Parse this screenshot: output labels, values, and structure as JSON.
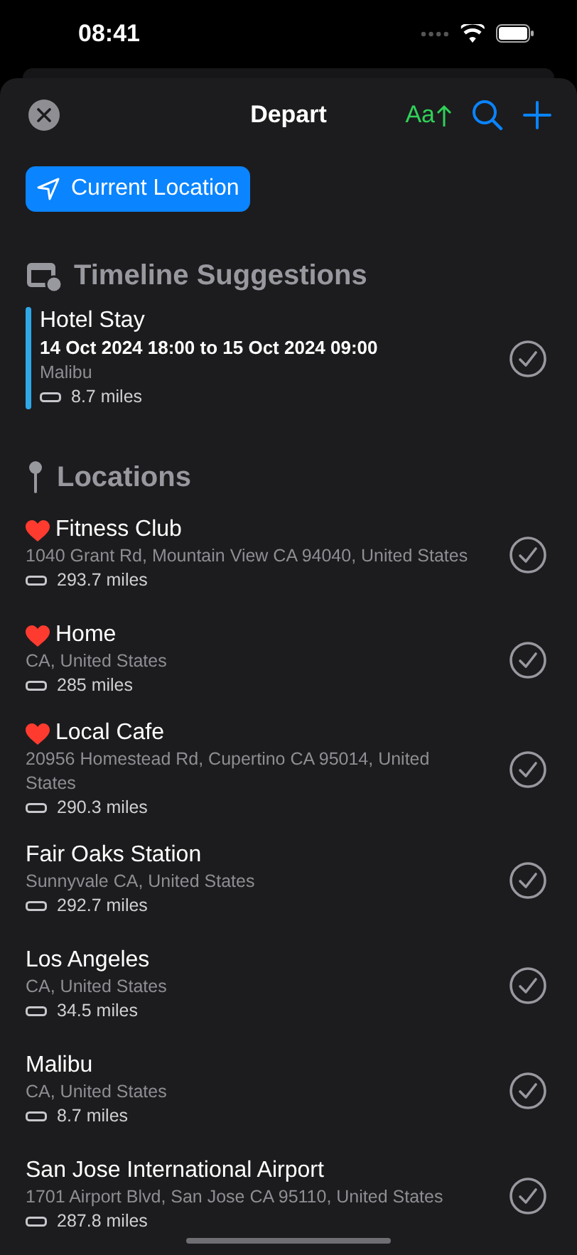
{
  "status_bar": {
    "time": "08:41"
  },
  "header": {
    "title": "Depart",
    "font_button": "Aa"
  },
  "current_location_button": "Current Location",
  "timeline": {
    "heading": "Timeline Suggestions",
    "items": [
      {
        "title": "Hotel Stay",
        "dates": "14 Oct 2024 18:00 to 15 Oct 2024 09:00",
        "place": "Malibu",
        "distance": "8.7 miles",
        "color": "#2fa8e8"
      }
    ]
  },
  "locations": {
    "heading": "Locations",
    "items": [
      {
        "name": "Fitness Club",
        "favorite": true,
        "address": "1040 Grant Rd, Mountain View CA 94040, United States",
        "distance": "293.7 miles"
      },
      {
        "name": "Home",
        "favorite": true,
        "address": "CA, United States",
        "distance": "285 miles"
      },
      {
        "name": "Local Cafe",
        "favorite": true,
        "address": "20956 Homestead Rd, Cupertino CA 95014, United States",
        "distance": "290.3 miles"
      },
      {
        "name": "Fair Oaks Station",
        "favorite": false,
        "address": "Sunnyvale CA, United States",
        "distance": "292.7 miles"
      },
      {
        "name": "Los Angeles",
        "favorite": false,
        "address": "CA, United States",
        "distance": "34.5 miles"
      },
      {
        "name": "Malibu",
        "favorite": false,
        "address": "CA, United States",
        "distance": "8.7 miles"
      },
      {
        "name": "San Jose International Airport",
        "favorite": false,
        "address": "1701 Airport Blvd, San Jose CA 95110, United States",
        "distance": "287.8 miles"
      }
    ]
  }
}
